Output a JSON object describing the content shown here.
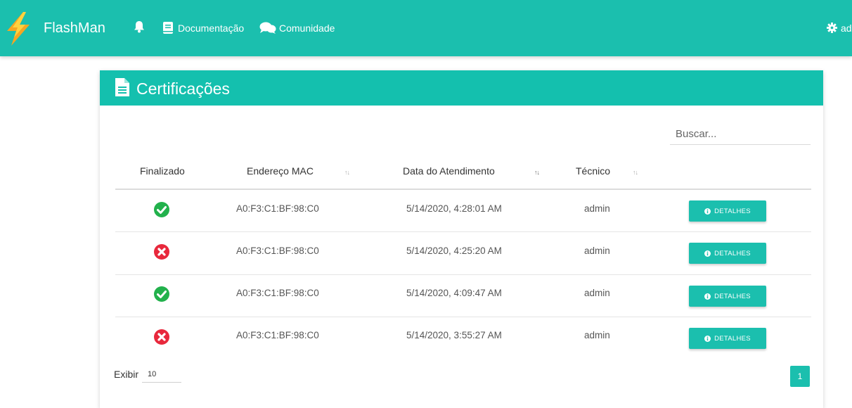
{
  "nav": {
    "brand": "FlashMan",
    "links": [
      "Documentação",
      "Comunidade"
    ],
    "user_label": "ad"
  },
  "card": {
    "title": "Certificações",
    "search": {
      "placeholder": "Buscar...",
      "value": ""
    },
    "columns": [
      "Finalizado",
      "Endereço MAC",
      "Data do Atendimento",
      "Técnico"
    ],
    "rows": [
      {
        "finalizado": true,
        "mac": "A0:F3:C1:BF:98:C0",
        "date": "5/14/2020, 4:28:01 AM",
        "tech": "admin",
        "action": "DETALHES"
      },
      {
        "finalizado": false,
        "mac": "A0:F3:C1:BF:98:C0",
        "date": "5/14/2020, 4:25:20 AM",
        "tech": "admin",
        "action": "DETALHES"
      },
      {
        "finalizado": true,
        "mac": "A0:F3:C1:BF:98:C0",
        "date": "5/14/2020, 4:09:47 AM",
        "tech": "admin",
        "action": "DETALHES"
      },
      {
        "finalizado": false,
        "mac": "A0:F3:C1:BF:98:C0",
        "date": "5/14/2020, 3:55:27 AM",
        "tech": "admin",
        "action": "DETALHES"
      }
    ],
    "pagination": {
      "show_label": "Exibir",
      "page_size": "10",
      "current_page": "1"
    }
  },
  "colors": {
    "accent": "#1bbfae",
    "success": "#22b14c",
    "error": "#e8283c"
  }
}
